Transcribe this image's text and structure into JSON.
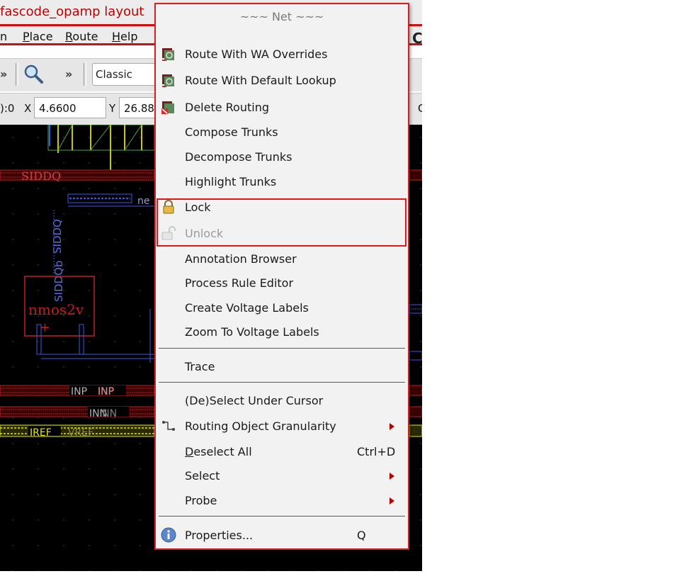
{
  "window": {
    "title": "fascode_opamp layout",
    "right_fragment": "C"
  },
  "menubar": {
    "items": [
      {
        "prefix": "",
        "mnemonic": "",
        "rest": "n"
      },
      {
        "prefix": "",
        "mnemonic": "P",
        "rest": "lace"
      },
      {
        "prefix": "",
        "mnemonic": "R",
        "rest": "oute"
      },
      {
        "prefix": "",
        "mnemonic": "H",
        "rest": "elp"
      }
    ]
  },
  "toolbar": {
    "chevron": "»",
    "view_combo": "Classic"
  },
  "coords": {
    "prefix": "):0",
    "x_label": "X",
    "x_value": "4.6600",
    "y_label": "Y",
    "y_value": "26.88",
    "end_glyph": "C"
  },
  "canvas": {
    "labels": {
      "siddq": "SIDDQ",
      "net_partial": "ne",
      "siddq_vertical": "SIDDQ",
      "siddqb": "SIDDQb",
      "nmos": "nmos2v",
      "plus": "+",
      "inp1": "INP",
      "inp2": "INP",
      "inn1": "INN",
      "inn2": "INN",
      "iref": "IREF",
      "vref": "VREF"
    },
    "colors": {
      "background": "#000000",
      "metal_red": "#c02020",
      "metal_blue": "#3a5ae8",
      "metal_yellow": "#e8e800",
      "poly_green": "#4aa84a"
    }
  },
  "context_menu": {
    "header": "~~~ Net ~~~",
    "items": {
      "route_wa": "Route With WA Overrides",
      "route_default": "Route With Default Lookup",
      "delete_routing": "Delete Routing",
      "compose_trunks": "Compose Trunks",
      "decompose_trunks": "Decompose Trunks",
      "highlight_trunks": "Highlight Trunks",
      "lock": "Lock",
      "unlock": "Unlock",
      "annotation_browser": "Annotation Browser",
      "process_rule_editor": "Process Rule Editor",
      "create_voltage_labels": "Create Voltage Labels",
      "zoom_voltage_labels": "Zoom To Voltage Labels",
      "trace": "Trace",
      "deselect_under_cursor": "(De)Select Under Cursor",
      "routing_granularity": "Routing Object Granularity",
      "deselect_all": "Deselect All",
      "deselect_all_shortcut": "Ctrl+D",
      "select": "Select",
      "probe": "Probe",
      "properties": "Properties...",
      "properties_shortcut": "Q"
    },
    "disabled": [
      "Unlock"
    ],
    "highlight_color": "#e01818"
  }
}
